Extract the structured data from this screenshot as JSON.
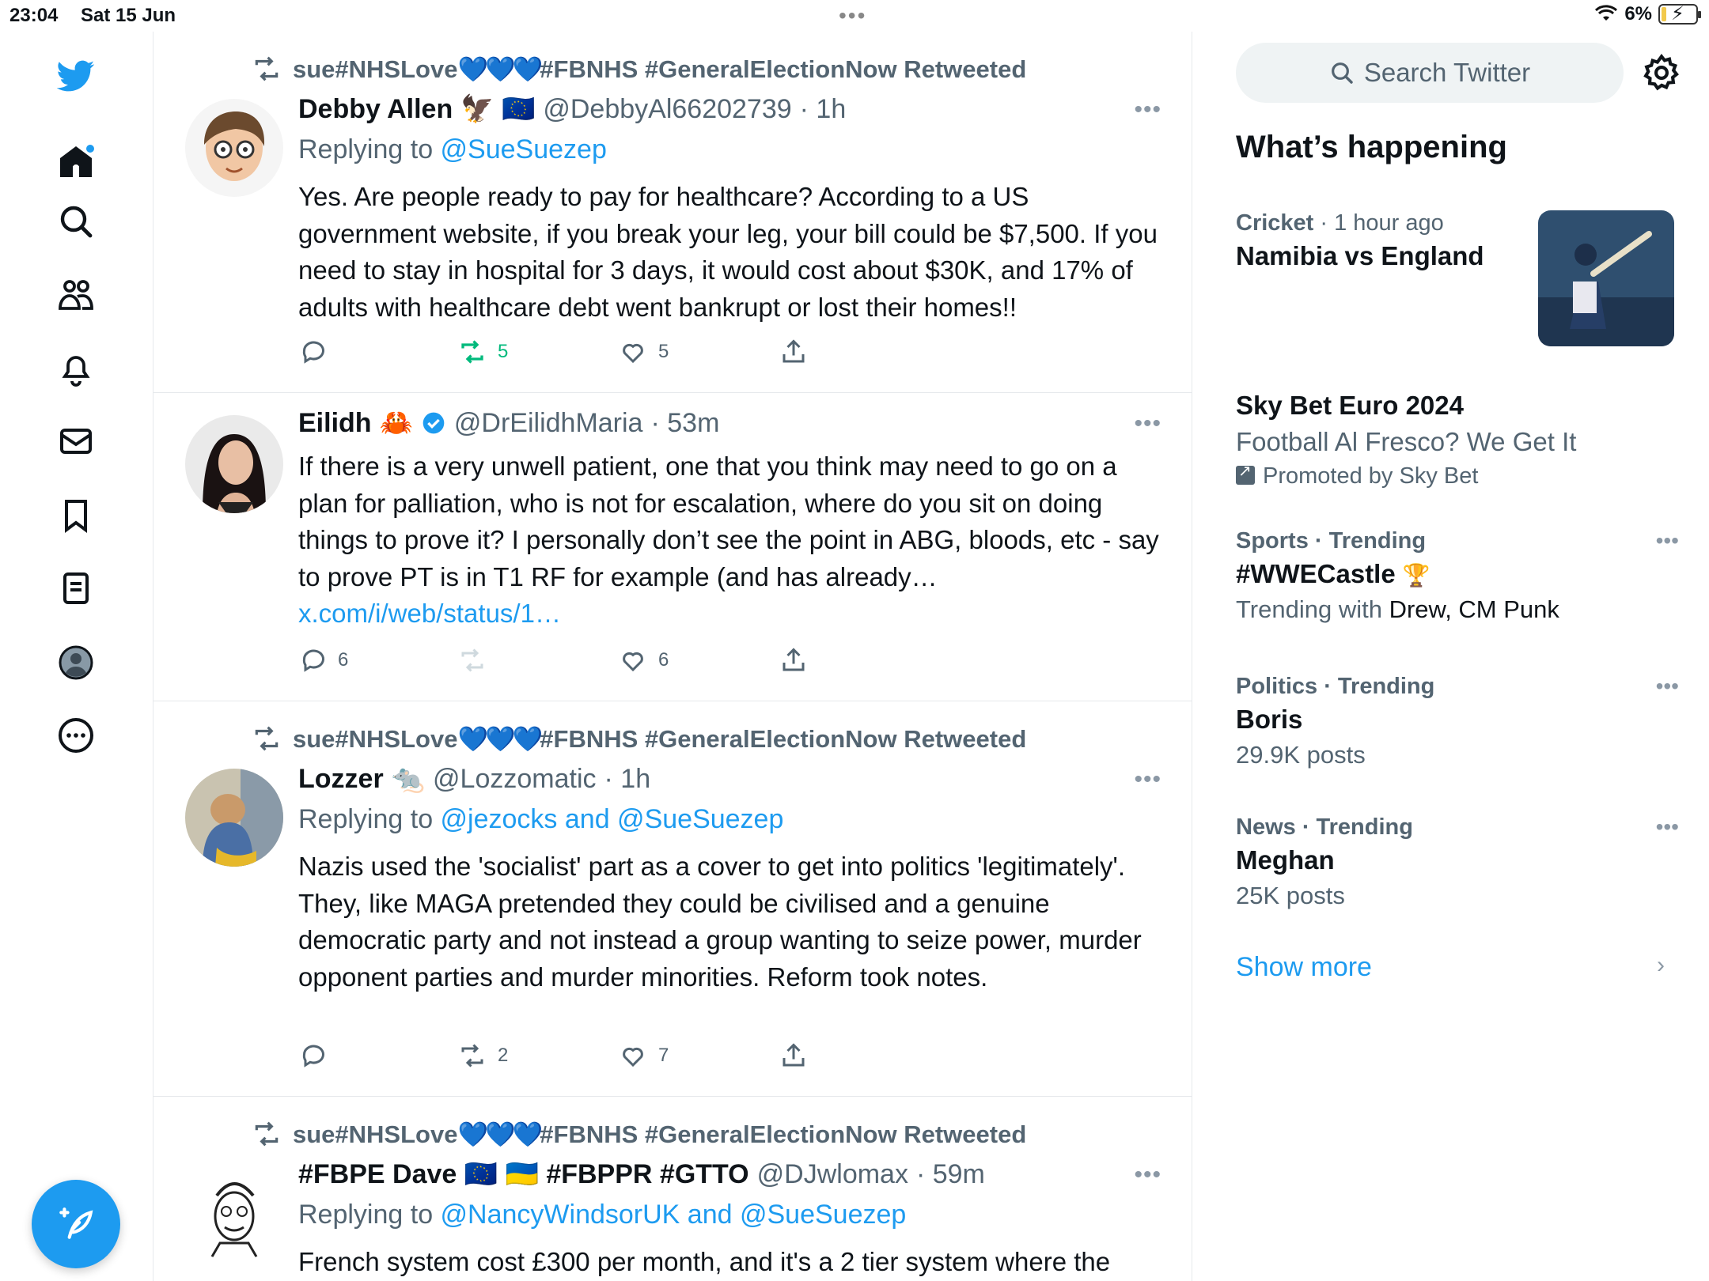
{
  "status_bar": {
    "time": "23:04",
    "date": "Sat 15 Jun",
    "battery": "6%"
  },
  "nav": {
    "icons": [
      "twitter-logo",
      "home-icon",
      "search-icon",
      "communities-icon",
      "notifications-icon",
      "messages-icon",
      "bookmarks-icon",
      "lists-icon",
      "profile-icon",
      "more-icon"
    ],
    "compose": "compose-icon"
  },
  "tweets": [
    {
      "retweeted_by_prefix": "sue#NHSLove",
      "retweeted_by_hearts": "💙💙💙",
      "retweeted_by_suffix": "#FBNHS #GeneralElectionNow Retweeted",
      "name": "Debby Allen",
      "name_badges": "🦅 🇪🇺",
      "handle": "@DebbyAl66202739",
      "time": "· 1h",
      "reply_prefix": "Replying to ",
      "reply_to": "@SueSuezep",
      "text": "Yes. Are people ready to pay for healthcare? According to a US government website, if you break your leg, your bill could be $7,500. If you need to stay in hospital for 3 days, it would cost about $30K, and 17% of adults with healthcare debt went bankrupt or lost their homes!!",
      "replies": "",
      "retweets": "5",
      "likes": "5"
    },
    {
      "name": "Eilidh",
      "name_badges": "🦀",
      "handle": "@DrEilidhMaria",
      "time": "· 53m",
      "text": "If there is a very unwell patient, one that you think may need to go on a plan for palliation, who is not for escalation, where do you sit on doing things to prove it? I personally don’t see the point in ABG, bloods, etc - say to prove PT is in T1 RF for example (and has already… ",
      "link": "x.com/i/web/status/1…",
      "replies": "6",
      "retweets": "",
      "likes": "6"
    },
    {
      "retweeted_by_prefix": "sue#NHSLove",
      "retweeted_by_hearts": "💙💙💙",
      "retweeted_by_suffix": "#FBNHS #GeneralElectionNow Retweeted",
      "name": "Lozzer",
      "name_badges": "🐀",
      "handle": "@Lozzomatic",
      "time": "· 1h",
      "reply_prefix": "Replying to ",
      "reply_to": "@jezocks and @SueSuezep",
      "text": "Nazis used the 'socialist' part as a cover to get into politics 'legitimately'. They, like MAGA pretended they could be civilised and a genuine democratic party and not instead a group wanting to seize power, murder opponent parties and murder minorities. Reform took notes.",
      "replies": "",
      "retweets": "2",
      "likes": "7"
    },
    {
      "retweeted_by_prefix": "sue#NHSLove",
      "retweeted_by_hearts": "💙💙💙",
      "retweeted_by_suffix": "#FBNHS #GeneralElectionNow Retweeted",
      "name": "#FBPE Dave 🇪🇺 🇺🇦 #FBPPR #GTTO",
      "handle": "@DJwlomax",
      "time": "· 59m",
      "reply_prefix": "Replying to ",
      "reply_to": "@NancyWindsorUK and @SueSuezep",
      "text": "French system cost £300 per month, and it's a 2 tier system where the"
    }
  ],
  "right": {
    "search_placeholder": "Search Twitter",
    "whats_happening": "What’s happening",
    "trends": [
      {
        "category": "Cricket",
        "meta": " · 1 hour ago",
        "title": "Namibia vs England"
      },
      {
        "title": "Sky Bet Euro 2024",
        "subtitle": "Football Al Fresco? We Get It",
        "promoted": "Promoted by Sky Bet"
      },
      {
        "category": "Sports · Trending",
        "title": "#WWECastle",
        "subtitle_prefix": "Trending with ",
        "subtitle_names": "Drew, CM Punk"
      },
      {
        "category": "Politics · Trending",
        "title": "Boris",
        "subtitle": "29.9K posts"
      },
      {
        "category": "News · Trending",
        "title": "Meghan",
        "subtitle": "25K posts"
      }
    ],
    "show_more": "Show more"
  },
  "colors": {
    "accent": "#1d9bf0",
    "retweet_green": "#00ba7c",
    "muted": "#536471"
  }
}
